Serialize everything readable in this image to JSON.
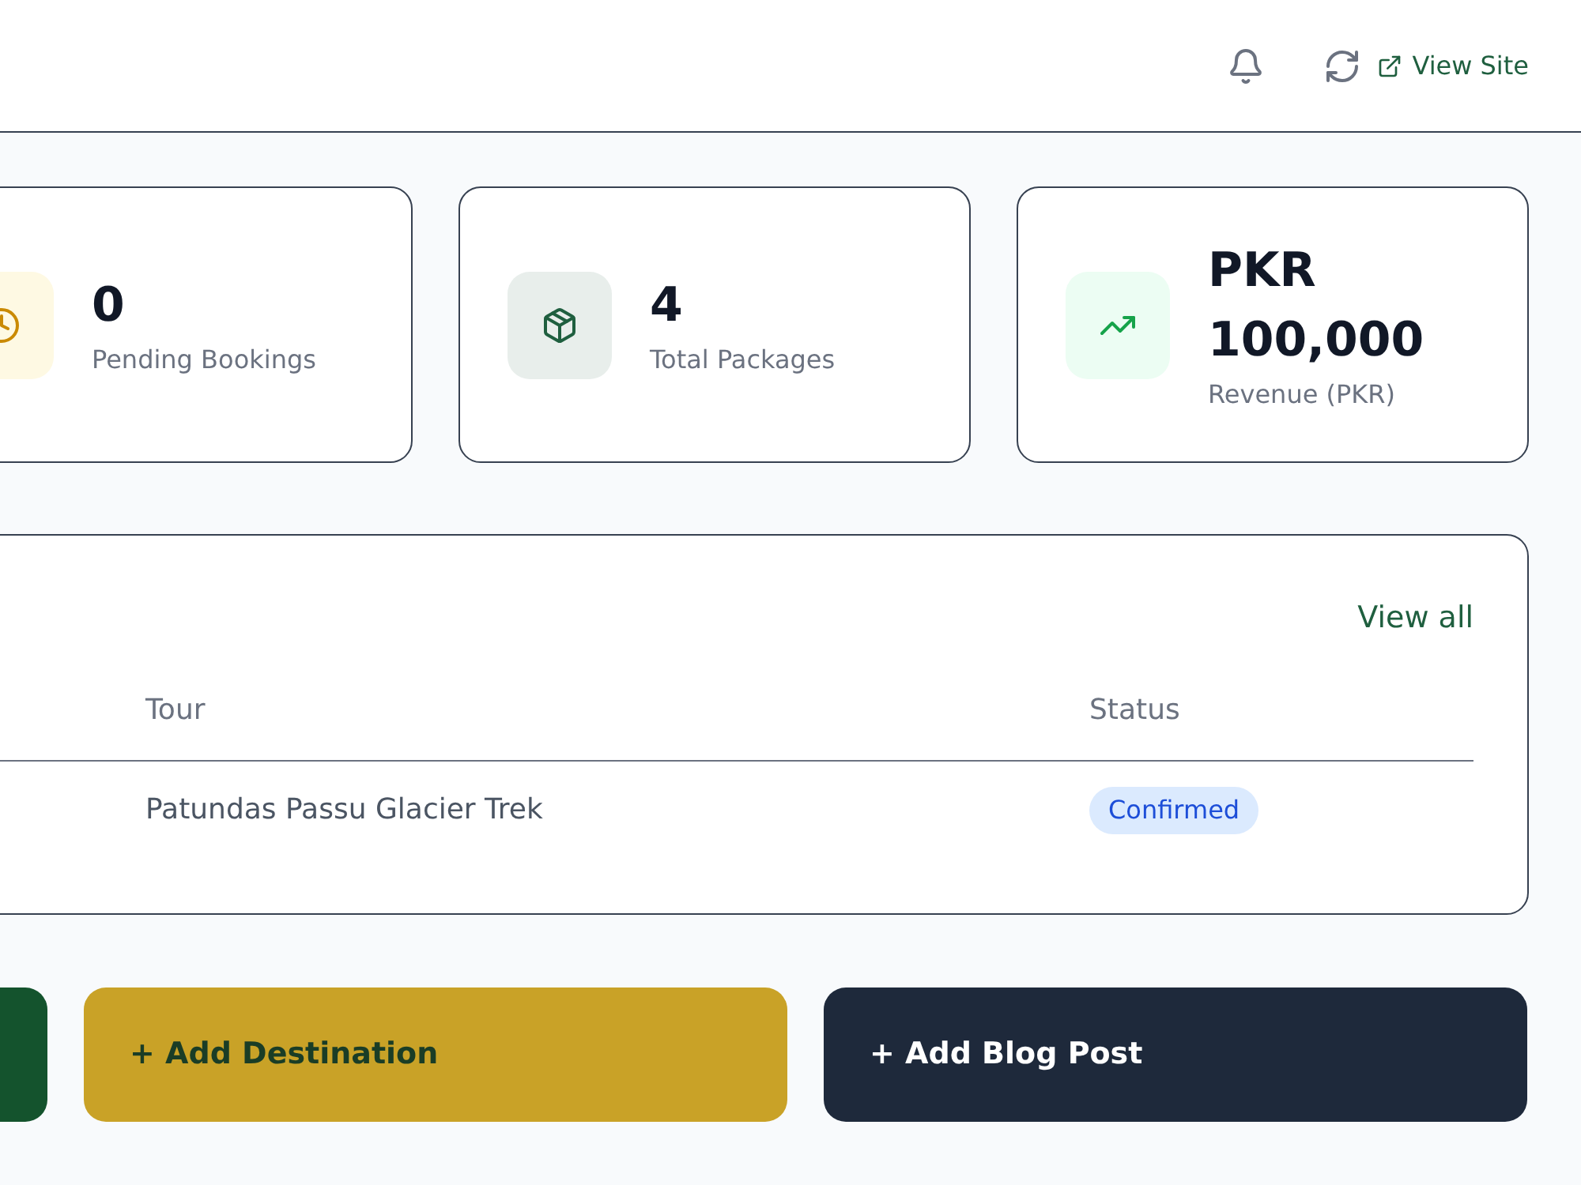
{
  "header": {
    "link": "View Site"
  },
  "stats": [
    {
      "kind": "pending",
      "value": "0",
      "label": "Pending Bookings"
    },
    {
      "kind": "packages",
      "value": "4",
      "label": "Total Packages"
    },
    {
      "kind": "revenue",
      "value": "PKR 100,000",
      "label": "Revenue (PKR)"
    }
  ],
  "bookings": {
    "link": "View all",
    "columns": [
      "Tour",
      "Status"
    ],
    "rows": [
      {
        "tour": "Patundas Passu Glacier Trek",
        "status": "Confirmed",
        "kind": "confirmed"
      }
    ]
  },
  "actions": [
    {
      "color": "#14532d"
    },
    {
      "label": "+ Add Destination",
      "color": "#c9a227"
    },
    {
      "label": "+ Add Blog Post",
      "color": "#1e293b"
    }
  ]
}
